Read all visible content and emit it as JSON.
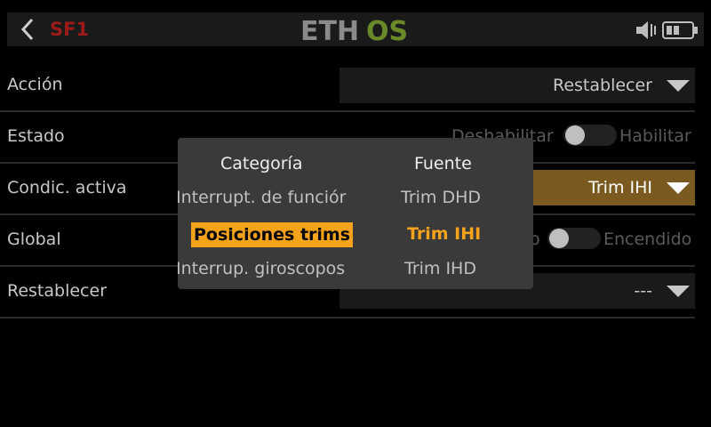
{
  "header": {
    "model_name": "SF1",
    "logo_text_left": "ETH",
    "logo_text_right": "OS",
    "logo_colors": {
      "left": "#8a8a8a",
      "right": "#6a8a2a"
    }
  },
  "rows": {
    "accion": {
      "label": "Acción",
      "value": "Restablecer"
    },
    "estado": {
      "label": "Estado",
      "off_label": "Deshabilitar",
      "on_label": "Habilitar"
    },
    "condic": {
      "label": "Condic. activa",
      "value": "Trim IHI"
    },
    "global": {
      "label": "Global",
      "off_label": "o",
      "on_label": "Encendido"
    },
    "restablecer": {
      "label": "Restablecer",
      "value": "---"
    }
  },
  "popup": {
    "category_header": "Categoría",
    "source_header": "Fuente",
    "categories": [
      "Interrupt. de funciór",
      "Posiciones trims",
      "Interrup. giroscopos"
    ],
    "sources": [
      "Trim DHD",
      "Trim IHI",
      "Trim IHD"
    ],
    "selected_category_index": 1,
    "selected_source_index": 1
  },
  "colors": {
    "accent": "#f5a31a",
    "model": "#9b1a1a",
    "active_field": "#7a5a1e"
  }
}
